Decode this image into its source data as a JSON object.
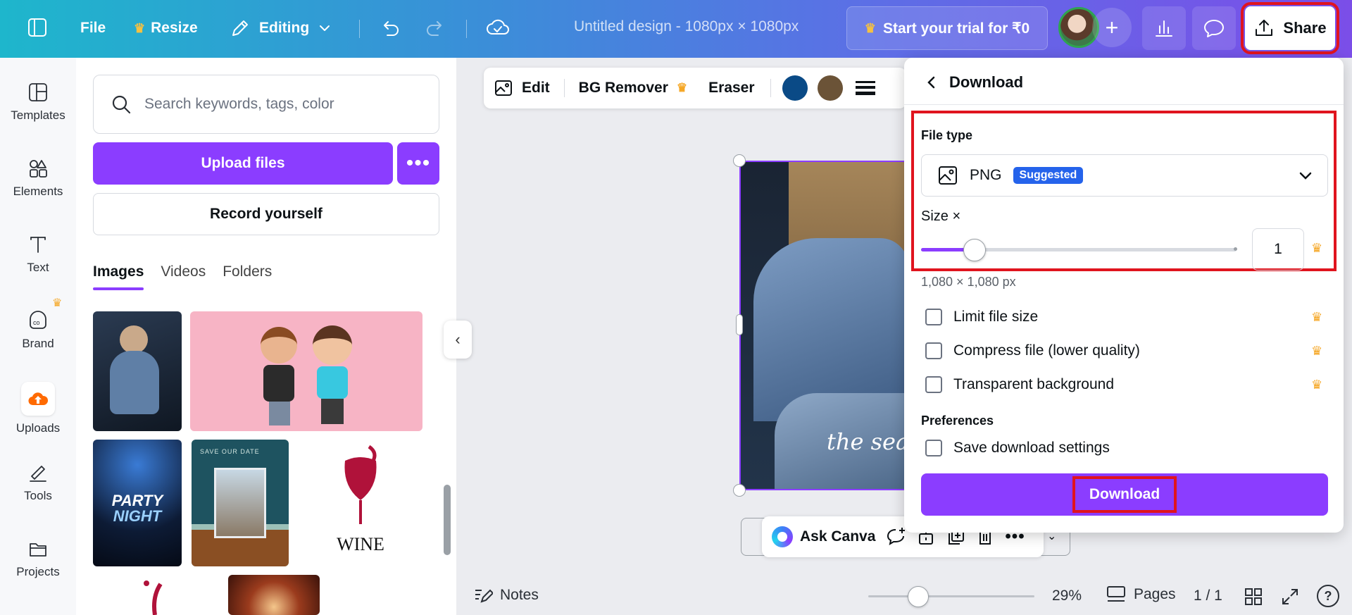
{
  "topbar": {
    "file_label": "File",
    "resize_label": "Resize",
    "editing_label": "Editing",
    "doc_title": "Untitled design - 1080px × 1080px",
    "trial_label": "Start your trial for ₹0",
    "share_label": "Share"
  },
  "rail": {
    "items": [
      {
        "label": "Templates"
      },
      {
        "label": "Elements"
      },
      {
        "label": "Text"
      },
      {
        "label": "Brand"
      },
      {
        "label": "Uploads"
      },
      {
        "label": "Tools"
      },
      {
        "label": "Projects"
      }
    ]
  },
  "panel": {
    "search_placeholder": "Search keywords, tags, color",
    "upload_label": "Upload files",
    "more_label": "•••",
    "record_label": "Record yourself",
    "tabs": [
      {
        "label": "Images",
        "active": true
      },
      {
        "label": "Videos",
        "active": false
      },
      {
        "label": "Folders",
        "active": false
      }
    ],
    "thumbs": {
      "party_line1": "PARTY",
      "party_line2": "NIGHT",
      "save_date": "SAVE OUR DATE",
      "wine": "WINE"
    }
  },
  "canvas": {
    "toolbar": {
      "edit_label": "Edit",
      "bg_remover_label": "BG Remover",
      "eraser_label": "Eraser",
      "swatch_colors": [
        "#0a4a86",
        "#6b5337"
      ]
    },
    "design_text": "the sea s",
    "ask_canva_label": "Ask Canva"
  },
  "bottombar": {
    "notes_label": "Notes",
    "zoom_value": "29%",
    "pages_label": "Pages",
    "page_count": "1 / 1"
  },
  "download": {
    "title": "Download",
    "file_type_label": "File type",
    "file_type_value": "PNG",
    "suggested_badge": "Suggested",
    "size_label": "Size ×",
    "size_value": "1",
    "size_slider_fraction": 0.17,
    "dimensions": "1,080 × 1,080 px",
    "options": [
      {
        "label": "Limit file size",
        "pro": true
      },
      {
        "label": "Compress file (lower quality)",
        "pro": true
      },
      {
        "label": "Transparent background",
        "pro": true
      }
    ],
    "preferences_label": "Preferences",
    "save_settings_label": "Save download settings",
    "download_button": "Download"
  },
  "colors": {
    "brand_purple": "#8b3dff",
    "highlight_red": "#e0141e",
    "crown_gold": "#f5a623"
  }
}
